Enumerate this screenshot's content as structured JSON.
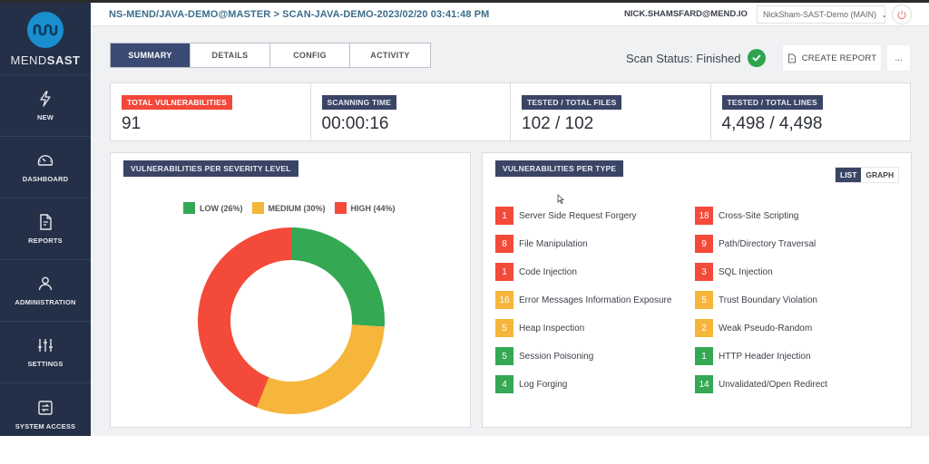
{
  "brand": {
    "name_light": "MEND",
    "name_bold": "SAST"
  },
  "sidebar": {
    "items": [
      {
        "label": "NEW",
        "icon": "lightning-icon"
      },
      {
        "label": "DASHBOARD",
        "icon": "speedometer-icon"
      },
      {
        "label": "REPORTS",
        "icon": "document-icon"
      },
      {
        "label": "ADMINISTRATION",
        "icon": "user-icon"
      },
      {
        "label": "SETTINGS",
        "icon": "sliders-icon"
      },
      {
        "label": "SYSTEM ACCESS",
        "icon": "swap-icon"
      }
    ]
  },
  "header": {
    "breadcrumb": "NS-MEND/JAVA-DEMO@MASTER > SCAN-JAVA-DEMO-2023/02/20 03:41:48 PM",
    "user_email": "NICK.SHAMSFARD@MEND.IO",
    "org_selected": "NickSham-SAST-Demo (MAIN)"
  },
  "tabs": [
    {
      "label": "SUMMARY",
      "active": true
    },
    {
      "label": "DETAILS",
      "active": false
    },
    {
      "label": "CONFIG",
      "active": false
    },
    {
      "label": "ACTIVITY",
      "active": false
    }
  ],
  "status": {
    "text": "Scan Status: Finished",
    "create_report": "CREATE REPORT",
    "more": "..."
  },
  "stats": [
    {
      "label": "TOTAL VULNERABILITIES",
      "value": "91",
      "highlight": true
    },
    {
      "label": "SCANNING TIME",
      "value": "00:00:16",
      "highlight": false
    },
    {
      "label": "TESTED / TOTAL FILES",
      "value": "102 / 102",
      "highlight": false
    },
    {
      "label": "TESTED / TOTAL LINES",
      "value": "4,498 / 4,498",
      "highlight": false
    }
  ],
  "severity_panel": {
    "title": "VULNERABILITIES PER SEVERITY LEVEL",
    "legend": [
      {
        "label": "LOW (26%)",
        "color": "#34a853"
      },
      {
        "label": "MEDIUM (30%)",
        "color": "#f6b63c"
      },
      {
        "label": "HIGH (44%)",
        "color": "#f44a3a"
      }
    ]
  },
  "chart_data": {
    "type": "pie",
    "title": "VULNERABILITIES PER SEVERITY LEVEL",
    "donut": true,
    "categories": [
      "LOW",
      "MEDIUM",
      "HIGH"
    ],
    "values": [
      26,
      30,
      44
    ],
    "colors": [
      "#34a853",
      "#f6b63c",
      "#f44a3a"
    ],
    "legend_position": "top"
  },
  "type_panel": {
    "title": "VULNERABILITIES PER TYPE",
    "toggle": {
      "list": "LIST",
      "graph": "GRAPH",
      "selected": "LIST"
    },
    "items": [
      {
        "count": "1",
        "name": "Server Side Request Forgery",
        "color": "#f44a3a"
      },
      {
        "count": "18",
        "name": "Cross-Site Scripting",
        "color": "#f44a3a"
      },
      {
        "count": "8",
        "name": "File Manipulation",
        "color": "#f44a3a"
      },
      {
        "count": "9",
        "name": "Path/Directory Traversal",
        "color": "#f44a3a"
      },
      {
        "count": "1",
        "name": "Code Injection",
        "color": "#f44a3a"
      },
      {
        "count": "3",
        "name": "SQL Injection",
        "color": "#f44a3a"
      },
      {
        "count": "16",
        "name": "Error Messages Information Exposure",
        "color": "#f6b63c"
      },
      {
        "count": "5",
        "name": "Trust Boundary Violation",
        "color": "#f6b63c"
      },
      {
        "count": "5",
        "name": "Heap Inspection",
        "color": "#f6b63c"
      },
      {
        "count": "2",
        "name": "Weak Pseudo-Random",
        "color": "#f6b63c"
      },
      {
        "count": "5",
        "name": "Session Poisoning",
        "color": "#34a853"
      },
      {
        "count": "1",
        "name": "HTTP Header Injection",
        "color": "#34a853"
      },
      {
        "count": "4",
        "name": "Log Forging",
        "color": "#34a853"
      },
      {
        "count": "14",
        "name": "Unvalidated/Open Redirect",
        "color": "#34a853"
      }
    ]
  }
}
